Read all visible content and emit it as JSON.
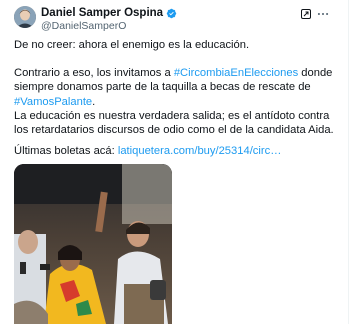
{
  "author": {
    "display_name": "Daniel Samper Ospina",
    "handle": "@DanielSamperO",
    "verified": true,
    "verified_color": "#1d9bf0"
  },
  "toolbar": {
    "grok_icon": "grok-icon",
    "more_icon": "more-options-icon"
  },
  "tweet": {
    "line1": "De no creer: ahora el enemigo es la educación.",
    "p2_a": "Contrario a eso, los invitamos a ",
    "p2_tag1": "#CircombiaEnElecciones",
    "p2_b": " donde siempre donamos parte de la taquilla a becas de rescate de ",
    "p2_tag2": "#VamosPalante",
    "p2_c": ".",
    "p3": "La educación es nuestra verdadera salida; es el antídoto contra los retardatarios  discursos de odio como el de la candidata Aida.",
    "p4_a": "Últimas boletas acá: ",
    "p4_link": "latiquetera.com/buy/25314/circ…",
    "link_color": "#1d9bf0"
  },
  "media": {
    "kind": "photo",
    "description_icon": "photo"
  }
}
